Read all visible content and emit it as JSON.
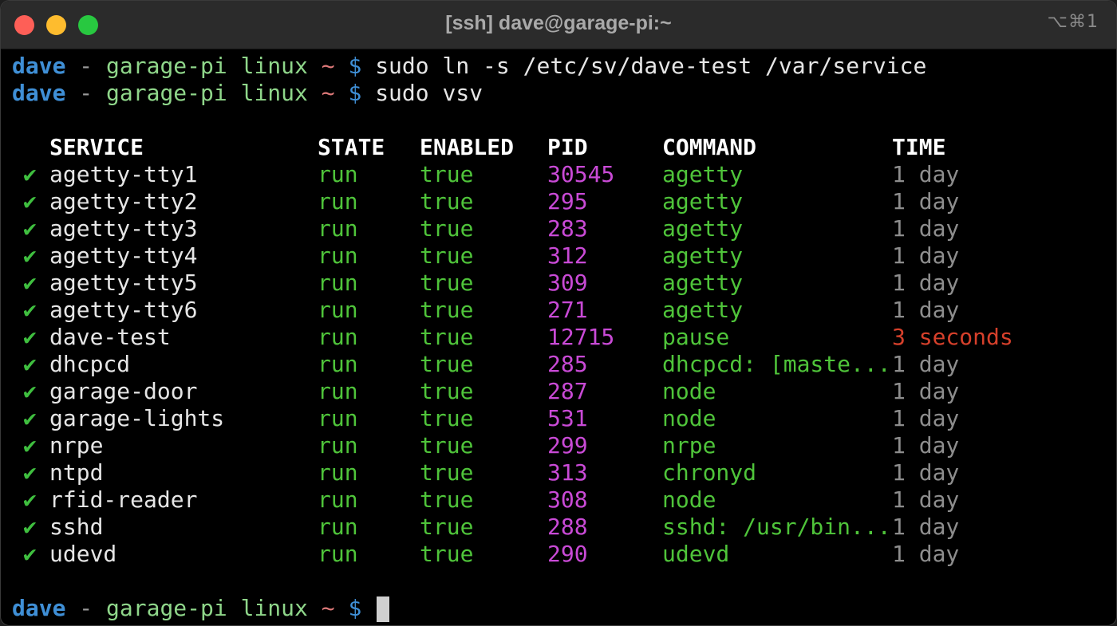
{
  "window": {
    "title": "[ssh] dave@garage-pi:~",
    "shortcut": "⌥⌘1"
  },
  "prompt": {
    "user": "dave",
    "sep": " - ",
    "host": "garage-pi",
    "dir": "linux",
    "tilde": "~",
    "dollar": "$"
  },
  "commands": [
    "sudo ln -s /etc/sv/dave-test /var/service",
    "sudo vsv"
  ],
  "table": {
    "headers": {
      "service": "SERVICE",
      "state": "STATE",
      "enabled": "ENABLED",
      "pid": "PID",
      "command": "COMMAND",
      "time": "TIME"
    },
    "rows": [
      {
        "status": "✔",
        "service": "agetty-tty1",
        "state": "run",
        "enabled": "true",
        "pid": "30545",
        "command": "agetty",
        "time": "1 day"
      },
      {
        "status": "✔",
        "service": "agetty-tty2",
        "state": "run",
        "enabled": "true",
        "pid": "295",
        "command": "agetty",
        "time": "1 day"
      },
      {
        "status": "✔",
        "service": "agetty-tty3",
        "state": "run",
        "enabled": "true",
        "pid": "283",
        "command": "agetty",
        "time": "1 day"
      },
      {
        "status": "✔",
        "service": "agetty-tty4",
        "state": "run",
        "enabled": "true",
        "pid": "312",
        "command": "agetty",
        "time": "1 day"
      },
      {
        "status": "✔",
        "service": "agetty-tty5",
        "state": "run",
        "enabled": "true",
        "pid": "309",
        "command": "agetty",
        "time": "1 day"
      },
      {
        "status": "✔",
        "service": "agetty-tty6",
        "state": "run",
        "enabled": "true",
        "pid": "271",
        "command": "agetty",
        "time": "1 day"
      },
      {
        "status": "✔",
        "service": "dave-test",
        "state": "run",
        "enabled": "true",
        "pid": "12715",
        "command": "pause",
        "time": "3 seconds",
        "recent": true
      },
      {
        "status": "✔",
        "service": "dhcpcd",
        "state": "run",
        "enabled": "true",
        "pid": "285",
        "command": "dhcpcd: [maste...",
        "time": "1 day"
      },
      {
        "status": "✔",
        "service": "garage-door",
        "state": "run",
        "enabled": "true",
        "pid": "287",
        "command": "node",
        "time": "1 day"
      },
      {
        "status": "✔",
        "service": "garage-lights",
        "state": "run",
        "enabled": "true",
        "pid": "531",
        "command": "node",
        "time": "1 day"
      },
      {
        "status": "✔",
        "service": "nrpe",
        "state": "run",
        "enabled": "true",
        "pid": "299",
        "command": "nrpe",
        "time": "1 day"
      },
      {
        "status": "✔",
        "service": "ntpd",
        "state": "run",
        "enabled": "true",
        "pid": "313",
        "command": "chronyd",
        "time": "1 day"
      },
      {
        "status": "✔",
        "service": "rfid-reader",
        "state": "run",
        "enabled": "true",
        "pid": "308",
        "command": "node",
        "time": "1 day"
      },
      {
        "status": "✔",
        "service": "sshd",
        "state": "run",
        "enabled": "true",
        "pid": "288",
        "command": "sshd: /usr/bin...",
        "time": "1 day"
      },
      {
        "status": "✔",
        "service": "udevd",
        "state": "run",
        "enabled": "true",
        "pid": "290",
        "command": "udevd",
        "time": "1 day"
      }
    ]
  },
  "colors": {
    "user": "#3f8fd6",
    "host": "#8fd68a",
    "tilde": "#e07a7a",
    "state": "#4fc43a",
    "pid": "#c94ad6",
    "time": "#8d8d8d",
    "time_recent": "#d6402b"
  }
}
